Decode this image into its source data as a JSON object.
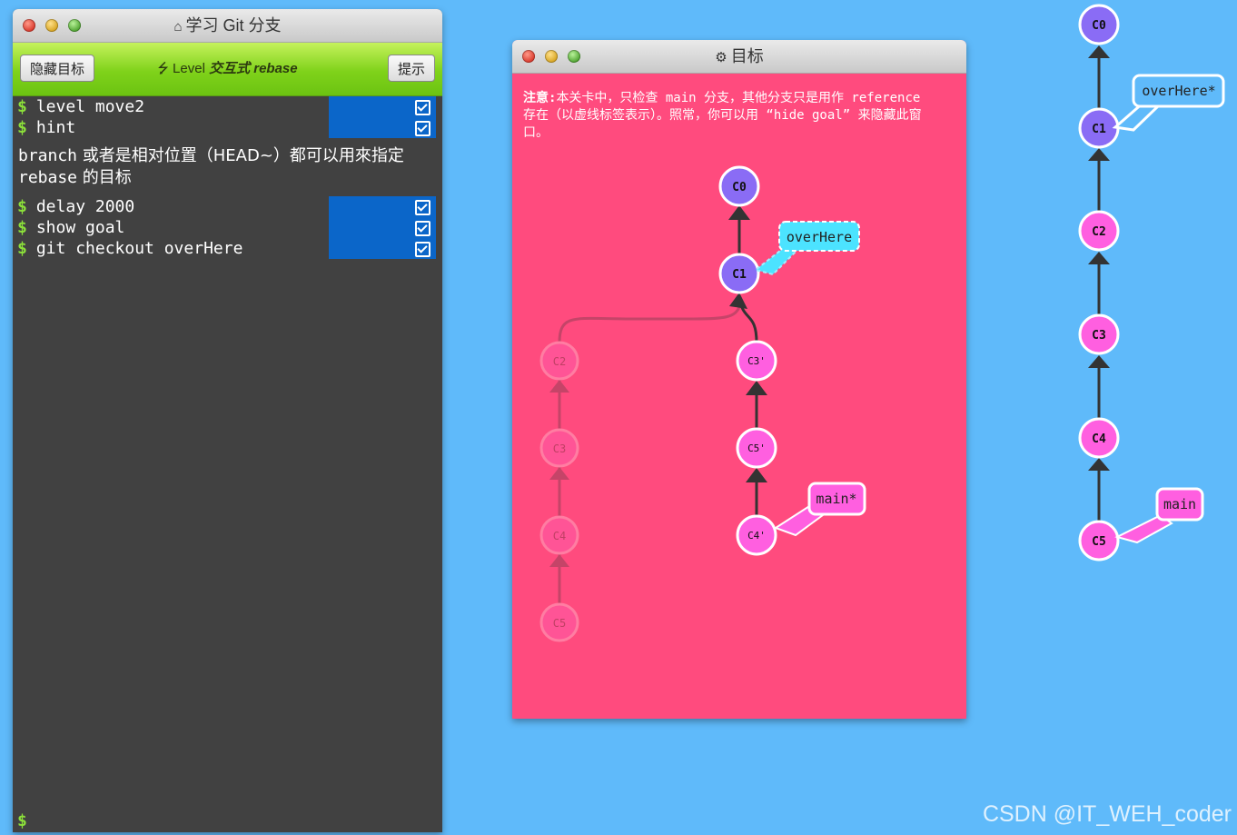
{
  "left_window": {
    "title": "学习 Git 分支",
    "hide_goal_button": "隐藏目标",
    "hint_button": "提示",
    "level_prefix": "Level",
    "level_name": "交互式 rebase"
  },
  "console": {
    "prompt_symbol": "$",
    "commands_1": [
      {
        "text": "level move2"
      },
      {
        "text": "hint"
      }
    ],
    "note_mono_1": "branch",
    "note_text_1": " 或者是相对位置（HEAD~）都可以用來指定 ",
    "note_mono_2": "rebase",
    "note_text_2": " 的目标",
    "commands_2": [
      {
        "text": "delay 2000"
      },
      {
        "text": "show goal"
      },
      {
        "text": "git checkout overHere"
      }
    ]
  },
  "goal_window": {
    "title": "目标",
    "note_bold": "注意:",
    "note_body": "本关卡中，只检查 main 分支，其他分支只是用作 reference 存在（以虚线标签表示）。照常，你可以用 “hide goal” 来隐藏此窗口。"
  },
  "goal_tree": {
    "commits": [
      "C0",
      "C1",
      "C3'",
      "C5'",
      "C4'"
    ],
    "ghost_commits": [
      "C2",
      "C3",
      "C4",
      "C5"
    ],
    "branches": [
      {
        "name": "overHere",
        "target": "C1"
      },
      {
        "name": "main*",
        "target": "C4'"
      }
    ]
  },
  "main_tree": {
    "commits": [
      "C0",
      "C1",
      "C2",
      "C3",
      "C4",
      "C5"
    ],
    "branches": [
      {
        "name": "overHere*",
        "target": "C1"
      },
      {
        "name": "main",
        "target": "C5"
      }
    ]
  },
  "colors": {
    "background": "#5fbafa",
    "commit_purple": "#8a6cf5",
    "commit_pink": "#ff5fe0",
    "goal_bg": "#ff4b7e",
    "terminal_bg": "#414141"
  },
  "watermark": "CSDN @IT_WEH_coder"
}
